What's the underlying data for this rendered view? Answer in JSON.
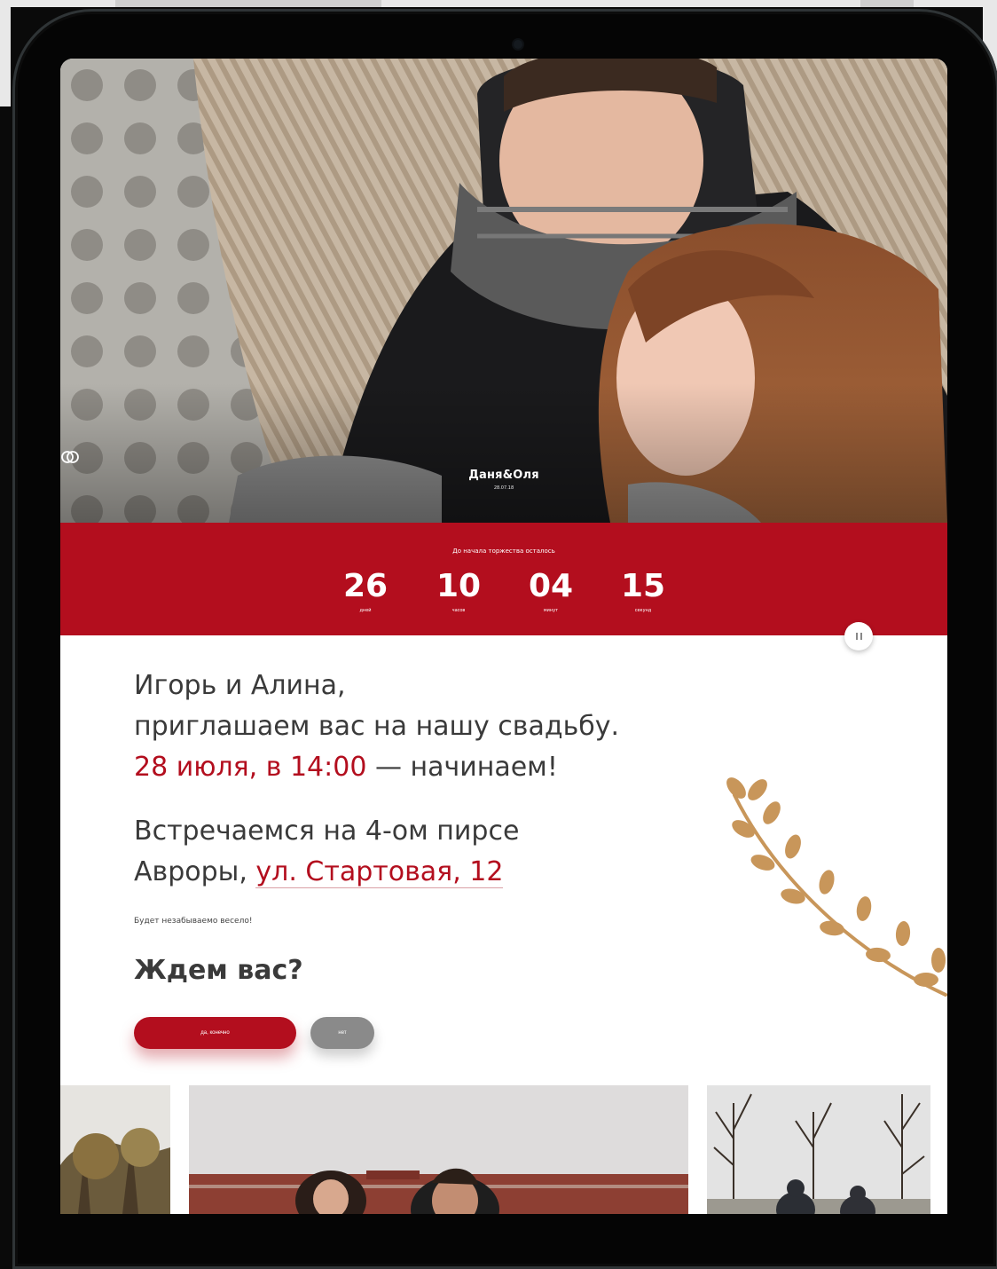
{
  "hero": {
    "couple": "Даня&Оля",
    "date": "28.07.18"
  },
  "countdown": {
    "caption": "До начала торжества осталось",
    "units": [
      {
        "value": "26",
        "label": "дней"
      },
      {
        "value": "10",
        "label": "часов"
      },
      {
        "value": "04",
        "label": "минут"
      },
      {
        "value": "15",
        "label": "секунд"
      }
    ]
  },
  "invitation": {
    "line1": "Игорь и Алина,",
    "line2": "приглашаем вас на нашу свадьбу.",
    "datetime": "28 июля, в 14:00",
    "start": " — начинаем!",
    "meet1": "Встречаемся на 4-ом пирсе",
    "meet2": "Авроры, ",
    "address": "ул. Стартовая, 12",
    "note": "Будет незабываемо весело!",
    "question": "Ждем вас?"
  },
  "rsvp": {
    "yes": "да, конечно",
    "no": "нет"
  },
  "colors": {
    "accent": "#b30e1e",
    "branch": "#c8965a"
  },
  "icons": [
    "rings-icon",
    "pause-icon",
    "branch-decoration"
  ]
}
